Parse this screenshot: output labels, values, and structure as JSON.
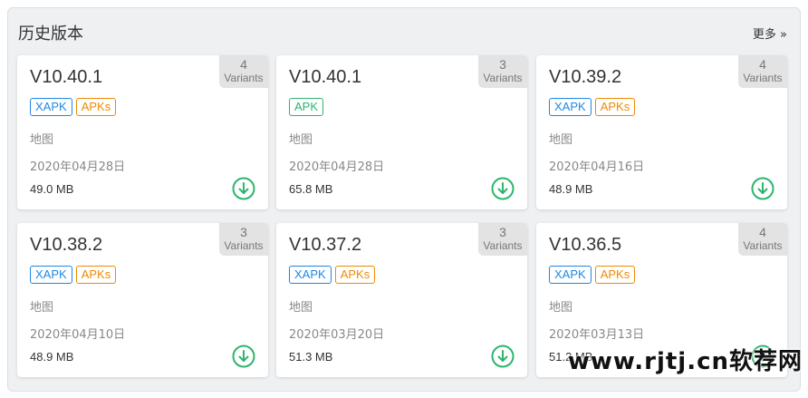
{
  "section": {
    "title": "历史版本",
    "more_label": "更多 »"
  },
  "cards": [
    {
      "version": "V10.40.1",
      "variants_count": "4",
      "variants_label": "Variants",
      "tags": [
        "XAPK",
        "APKs"
      ],
      "category": "地图",
      "date": "2020年04月28日",
      "size": "49.0 MB"
    },
    {
      "version": "V10.40.1",
      "variants_count": "3",
      "variants_label": "Variants",
      "tags": [
        "APK"
      ],
      "category": "地图",
      "date": "2020年04月28日",
      "size": "65.8 MB"
    },
    {
      "version": "V10.39.2",
      "variants_count": "4",
      "variants_label": "Variants",
      "tags": [
        "XAPK",
        "APKs"
      ],
      "category": "地图",
      "date": "2020年04月16日",
      "size": "48.9 MB"
    },
    {
      "version": "V10.38.2",
      "variants_count": "3",
      "variants_label": "Variants",
      "tags": [
        "XAPK",
        "APKs"
      ],
      "category": "地图",
      "date": "2020年04月10日",
      "size": "48.9 MB"
    },
    {
      "version": "V10.37.2",
      "variants_count": "3",
      "variants_label": "Variants",
      "tags": [
        "XAPK",
        "APKs"
      ],
      "category": "地图",
      "date": "2020年03月20日",
      "size": "51.3 MB"
    },
    {
      "version": "V10.36.5",
      "variants_count": "4",
      "variants_label": "Variants",
      "tags": [
        "XAPK",
        "APKs"
      ],
      "category": "地图",
      "date": "2020年03月13日",
      "size": "51.2 MB"
    }
  ],
  "colors": {
    "accent_green": "#2cb56c",
    "xapk_blue": "#1e88e5",
    "apks_orange": "#f08a00"
  },
  "icons": {
    "download": "download-circle-icon"
  },
  "watermark": "www.rjtj.cn软荐网"
}
